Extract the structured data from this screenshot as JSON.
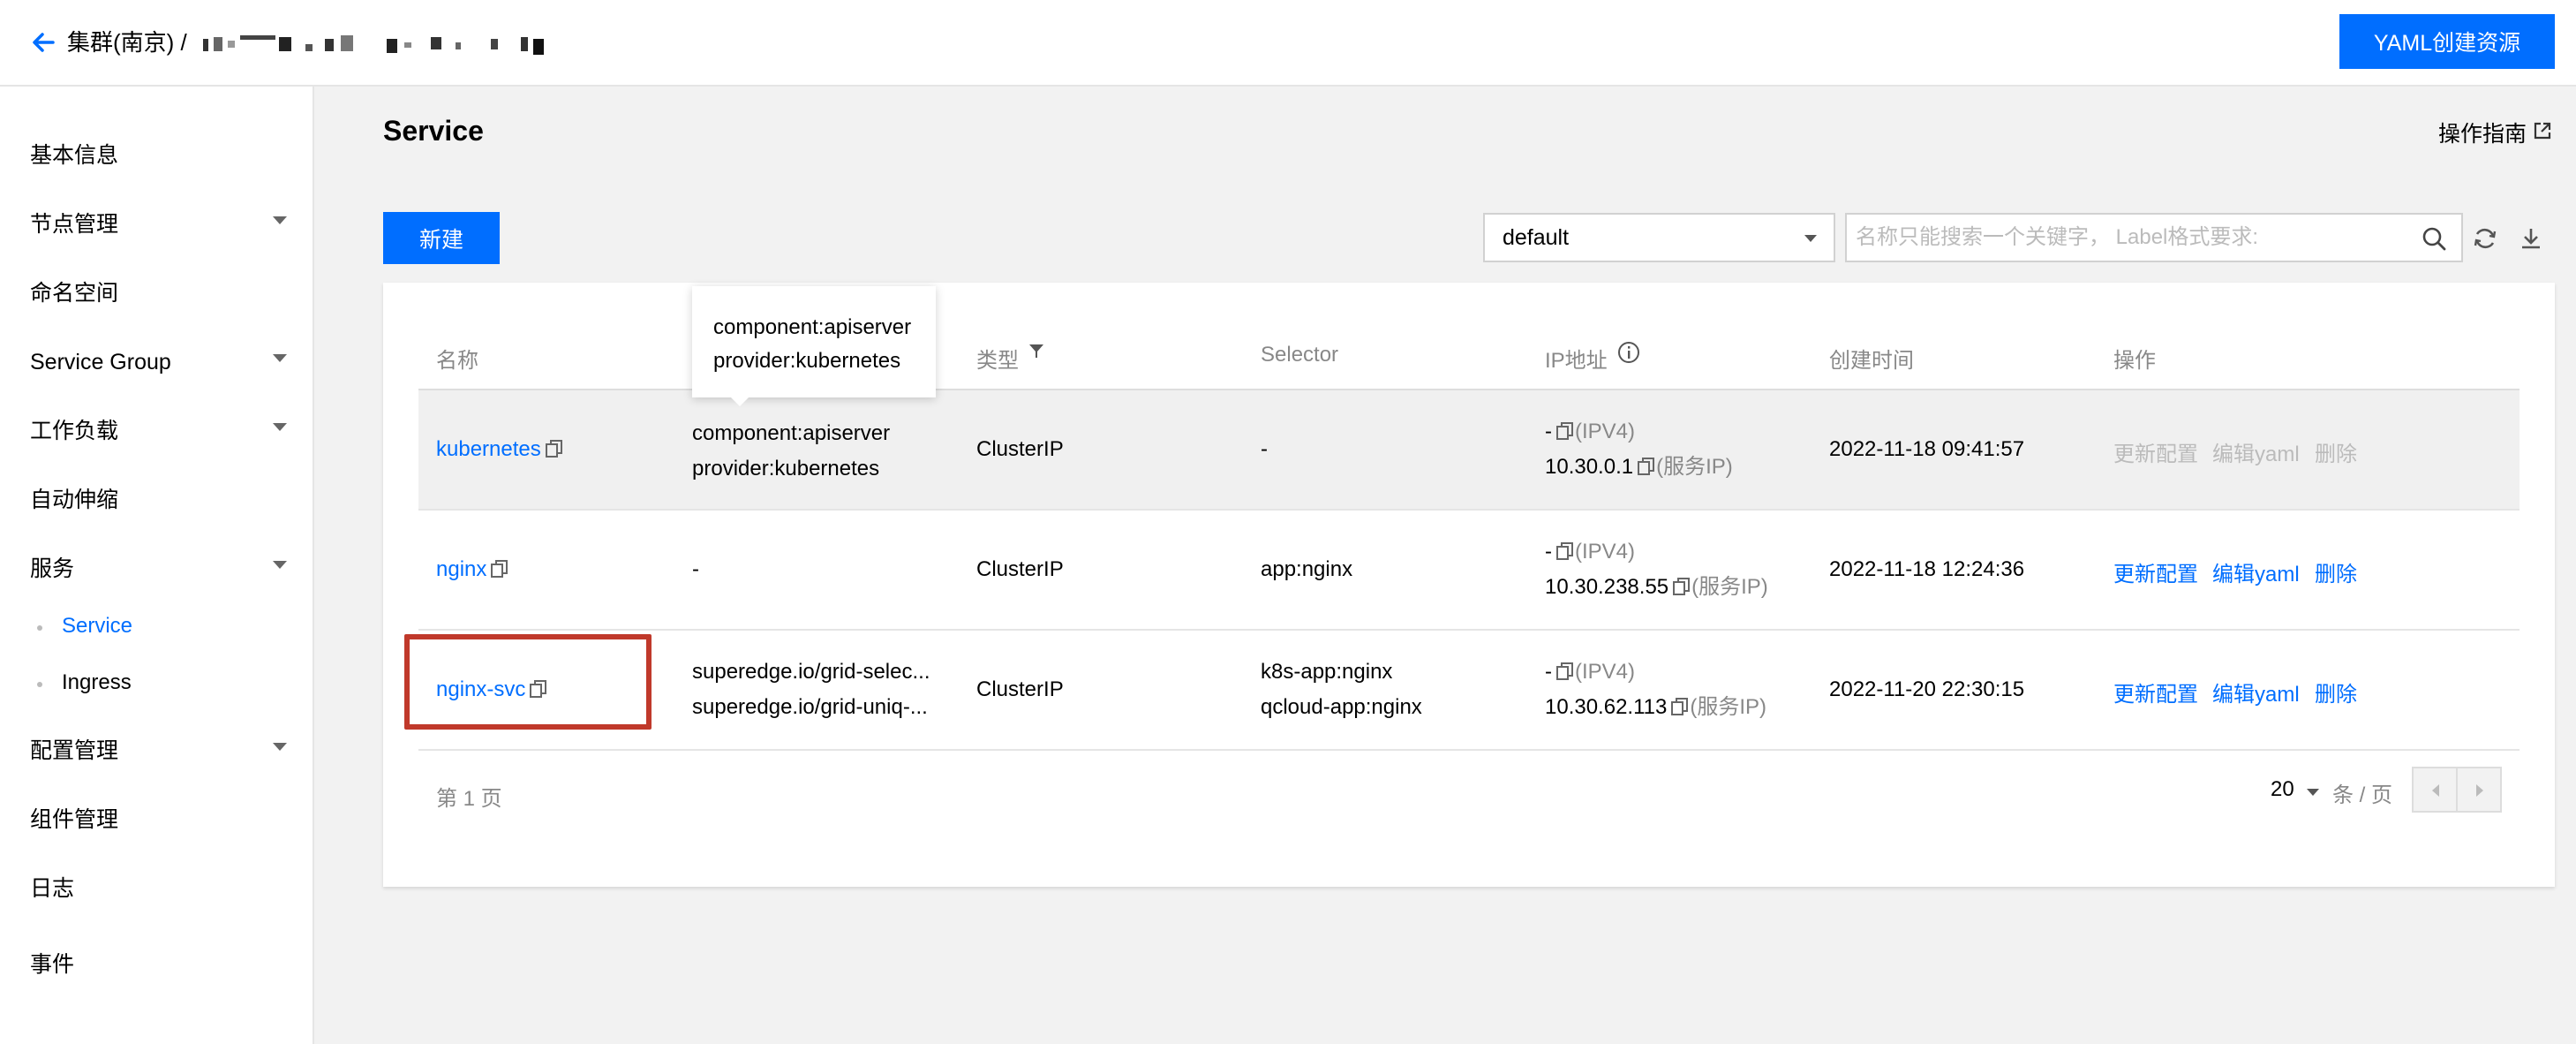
{
  "header": {
    "breadcrumb_cluster": "集群(南京) /",
    "yaml_button": "YAML创建资源"
  },
  "sidebar": {
    "items": [
      {
        "label": "基本信息"
      },
      {
        "label": "节点管理"
      },
      {
        "label": "命名空间"
      },
      {
        "label": "Service Group"
      },
      {
        "label": "工作负载"
      },
      {
        "label": "自动伸缩"
      },
      {
        "label": "服务"
      },
      {
        "label": "配置管理"
      },
      {
        "label": "组件管理"
      },
      {
        "label": "日志"
      },
      {
        "label": "事件"
      }
    ],
    "sub_items": [
      {
        "label": "Service"
      },
      {
        "label": "Ingress"
      }
    ]
  },
  "main": {
    "title": "Service",
    "guide_link": "操作指南",
    "new_button": "新建",
    "namespace_select": "default",
    "search_placeholder": "名称只能搜索一个关键字， Label格式要求:"
  },
  "table": {
    "headers": [
      "名称",
      "Selector",
      "类型",
      "Selector",
      "IP地址",
      "创建时间",
      "操作"
    ],
    "rows": [
      {
        "name": "kubernetes",
        "labels": [
          "component:apiserver",
          "provider:kubernetes"
        ],
        "type": "ClusterIP",
        "selector": "-",
        "ip1": "-",
        "ip1_tag": "(IPV4)",
        "ip2": "10.30.0.1",
        "ip2_tag": "(服务IP)",
        "created": "2022-11-18 09:41:57"
      },
      {
        "name": "nginx",
        "labels": [
          "-"
        ],
        "type": "ClusterIP",
        "selector": "app:nginx",
        "ip1": "-",
        "ip1_tag": "(IPV4)",
        "ip2": "10.30.238.55",
        "ip2_tag": "(服务IP)",
        "created": "2022-11-18 12:24:36"
      },
      {
        "name": "nginx-svc",
        "labels": [
          "superedge.io/grid-selec...",
          "superedge.io/grid-uniq-..."
        ],
        "type": "ClusterIP",
        "selector": "k8s-app:nginx",
        "selector2": "qcloud-app:nginx",
        "ip1": "-",
        "ip1_tag": "(IPV4)",
        "ip2": "10.30.62.113",
        "ip2_tag": "(服务IP)",
        "created": "2022-11-20 22:30:15"
      }
    ],
    "actions": [
      "更新配置",
      "编辑yaml",
      "删除"
    ]
  },
  "tooltip": {
    "line1": "component:apiserver",
    "line2": "provider:kubernetes"
  },
  "pagination": {
    "page_text": "第 1 页",
    "page_size": "20",
    "per_page": "条 / 页"
  },
  "colors": {
    "primary": "#006eff",
    "highlight": "#c0392b",
    "disabled": "#bbbbbb"
  }
}
